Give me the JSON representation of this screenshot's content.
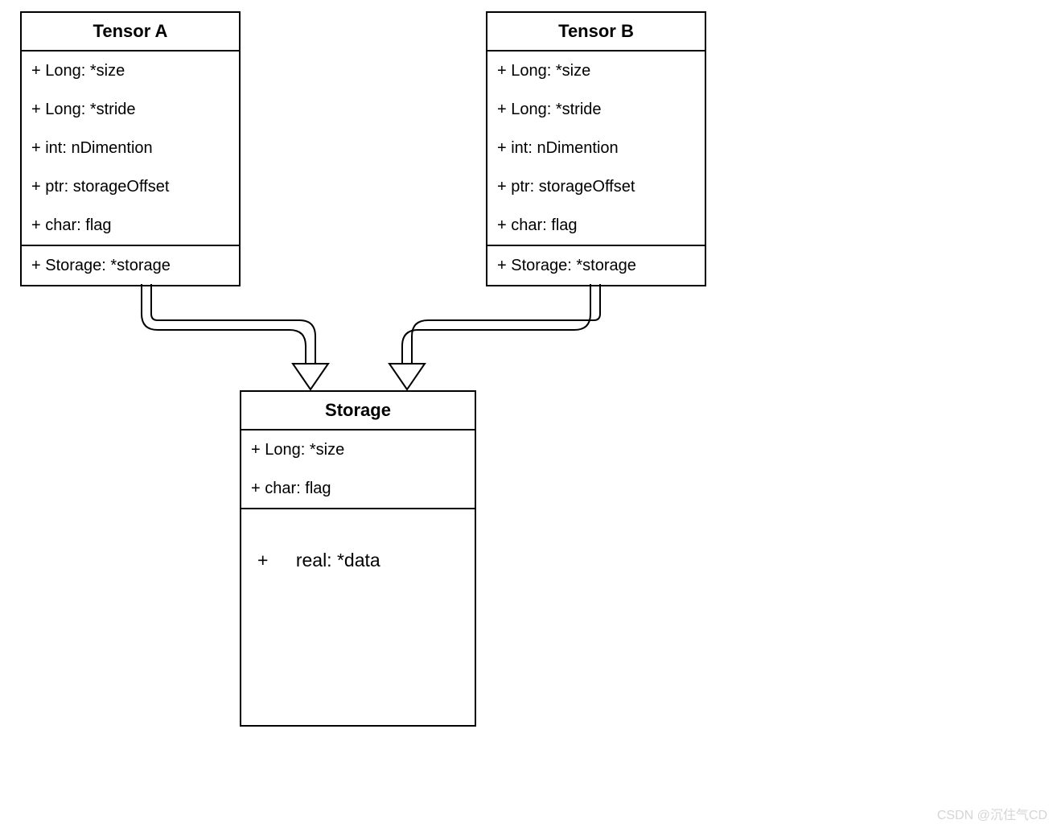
{
  "tensorA": {
    "title": "Tensor A",
    "attrs": [
      "+ Long: *size",
      "+ Long: *stride",
      "+ int:  nDimention",
      "+ ptr: storageOffset",
      "+ char: flag"
    ],
    "refs": [
      "+ Storage: *storage"
    ]
  },
  "tensorB": {
    "title": "Tensor B",
    "attrs": [
      "+ Long: *size",
      "+ Long: *stride",
      "+ int:  nDimention",
      "+ ptr: storageOffset",
      "+ char: flag"
    ],
    "refs": [
      "+ Storage: *storage"
    ]
  },
  "storage": {
    "title": "Storage",
    "attrs": [
      "+ Long: *size",
      "+ char: flag"
    ],
    "dataPlus": "+",
    "dataLabel": "real: *data"
  },
  "watermark": "CSDN @沉住气CD"
}
